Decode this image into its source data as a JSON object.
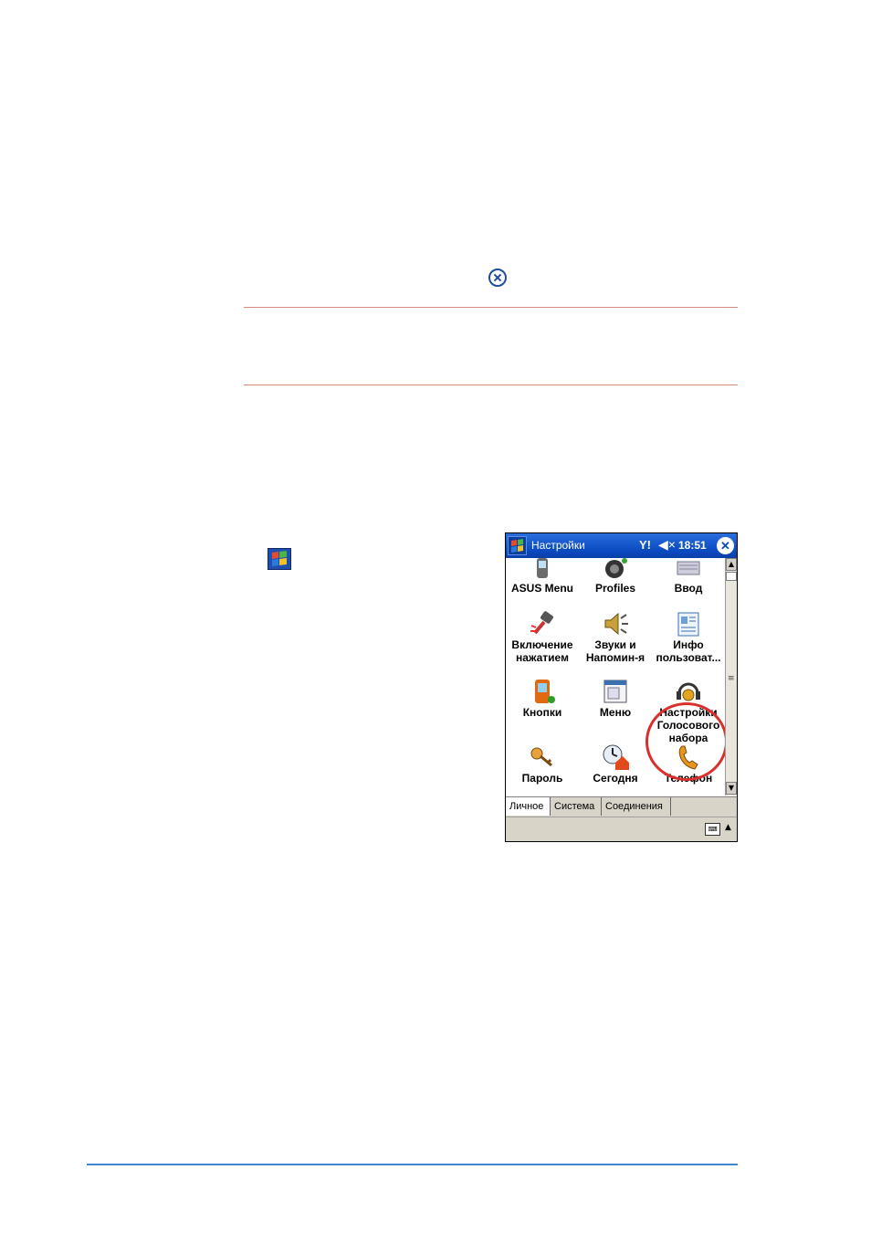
{
  "pda": {
    "titlebar": {
      "title": "Настройки",
      "signal": "Y!",
      "volume_glyph": "◀×",
      "time": "18:51",
      "ok_glyph": "✕"
    },
    "items": [
      {
        "label": "ASUS Menu",
        "icon": "asus-menu-icon"
      },
      {
        "label": "Profiles",
        "icon": "profiles-icon"
      },
      {
        "label": "Ввод",
        "icon": "input-icon"
      },
      {
        "label": "Включение\nнажатием",
        "icon": "hammer-icon"
      },
      {
        "label": "Звуки и\nНапомин-я",
        "icon": "speaker-icon"
      },
      {
        "label": "Инфо\nпользоват...",
        "icon": "owner-info-icon"
      },
      {
        "label": "Кнопки",
        "icon": "buttons-icon"
      },
      {
        "label": "Меню",
        "icon": "menu-icon"
      },
      {
        "label": "Настройки\nГолосового\nнабора",
        "icon": "voice-dial-icon"
      },
      {
        "label": "Пароль",
        "icon": "keys-icon"
      },
      {
        "label": "Сегодня",
        "icon": "today-icon"
      },
      {
        "label": "Телефон",
        "icon": "phone-icon"
      }
    ],
    "tabs": [
      "Личное",
      "Система",
      "Соединения"
    ],
    "active_tab": "Личное",
    "scroll": {
      "up": "▲",
      "down": "▼",
      "grip": "≡"
    },
    "keyboard_arrow": "▲",
    "keyboard_label": "⌨"
  },
  "colors": {
    "titlebar": "#0b4ac2",
    "highlight": "#d9302b",
    "rule_top": "#d98c7a",
    "rule_bottom": "#3f86cf"
  }
}
